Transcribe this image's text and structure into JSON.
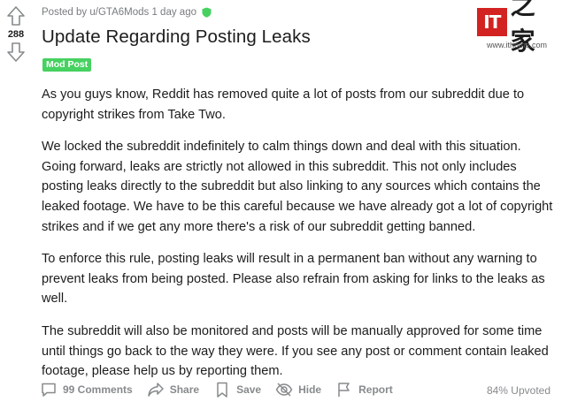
{
  "vote": {
    "count": "288"
  },
  "post": {
    "meta_prefix": "Posted by",
    "author": "u/GTA6Mods",
    "time": "1 day ago",
    "title": "Update Regarding Posting Leaks",
    "flair": "Mod Post",
    "paragraphs": [
      "As you guys know, Reddit has removed quite a lot of posts from our subreddit due to copyright strikes from Take Two.",
      "We locked the subreddit indefinitely to calm things down and deal with this situation. Going forward, leaks are strictly not allowed in this subreddit. This not only includes posting leaks directly to the subreddit but also linking to any sources which contains the leaked footage. We have to be this careful because we have already got a lot of copyright strikes and if we get any more there's a risk of our subreddit getting banned.",
      "To enforce this rule, posting leaks will result in a permanent ban without any warning to prevent leaks from being posted. Please also refrain from asking for links to the leaks as well.",
      "The subreddit will also be monitored and posts will be manually approved for some time until things go back to the way they were. If you see any post or comment contain leaked footage, please help us by reporting them."
    ]
  },
  "actions": {
    "comments": "99 Comments",
    "share": "Share",
    "save": "Save",
    "hide": "Hide",
    "report": "Report",
    "upvoted": "84% Upvoted"
  },
  "watermark": {
    "logo_text": "IT",
    "logo_char": "之家",
    "url": "www.ithome.com"
  },
  "colors": {
    "flair_bg": "#46d160",
    "meta_text": "#787c7e",
    "action_text": "#878a8c",
    "watermark_red": "#d22222"
  }
}
